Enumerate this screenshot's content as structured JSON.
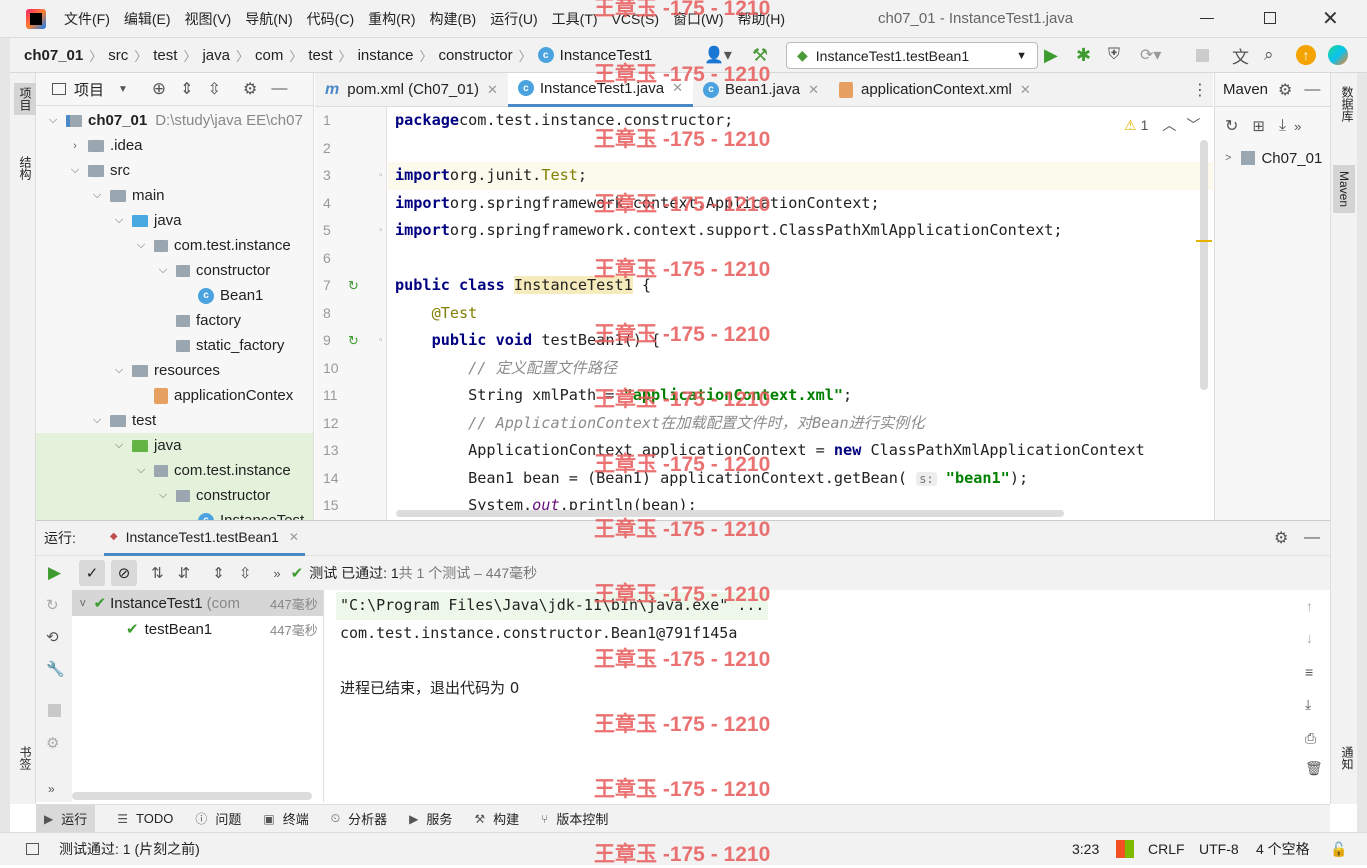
{
  "titlebar": {
    "menus": [
      "文件(F)",
      "编辑(E)",
      "视图(V)",
      "导航(N)",
      "代码(C)",
      "重构(R)",
      "构建(B)",
      "运行(U)",
      "工具(T)",
      "VCS(S)",
      "窗口(W)",
      "帮助(H)"
    ],
    "title": "ch07_01 - InstanceTest1.java"
  },
  "breadcrumb": [
    "ch07_01",
    "src",
    "test",
    "java",
    "com",
    "test",
    "instance",
    "constructor",
    "InstanceTest1"
  ],
  "run_config": "InstanceTest1.testBean1",
  "left_strip": {
    "project": "项目",
    "structure": "结构",
    "bookmarks": "书签"
  },
  "right_strip": {
    "database": "数据库",
    "maven": "Maven",
    "notifications": "通知"
  },
  "project_panel": {
    "title": "项目",
    "tree": [
      {
        "label": "ch07_01",
        "extra": "D:\\study\\java EE\\ch07",
        "indent": 0,
        "icon": "module",
        "chev": "v",
        "bold": true
      },
      {
        "label": ".idea",
        "indent": 1,
        "icon": "folder",
        "chev": ">"
      },
      {
        "label": "src",
        "indent": 1,
        "icon": "folder",
        "chev": "v"
      },
      {
        "label": "main",
        "indent": 2,
        "icon": "folder",
        "chev": "v"
      },
      {
        "label": "java",
        "indent": 3,
        "icon": "folder-blue",
        "chev": "v"
      },
      {
        "label": "com.test.instance",
        "indent": 4,
        "icon": "package",
        "chev": "v"
      },
      {
        "label": "constructor",
        "indent": 5,
        "icon": "package",
        "chev": "v"
      },
      {
        "label": "Bean1",
        "indent": 6,
        "icon": "class",
        "chev": ""
      },
      {
        "label": "factory",
        "indent": 5,
        "icon": "package",
        "chev": ""
      },
      {
        "label": "static_factory",
        "indent": 5,
        "icon": "package",
        "chev": ""
      },
      {
        "label": "resources",
        "indent": 3,
        "icon": "folder",
        "chev": "v"
      },
      {
        "label": "applicationContex",
        "indent": 4,
        "icon": "xml",
        "chev": ""
      },
      {
        "label": "test",
        "indent": 2,
        "icon": "folder",
        "chev": "v"
      },
      {
        "label": "java",
        "indent": 3,
        "icon": "folder-green",
        "chev": "v",
        "sel": true
      },
      {
        "label": "com.test.instance",
        "indent": 4,
        "icon": "package",
        "chev": "v",
        "sel": true
      },
      {
        "label": "constructor",
        "indent": 5,
        "icon": "package",
        "chev": "v",
        "sel": true
      },
      {
        "label": "InstanceTest",
        "indent": 6,
        "icon": "class",
        "chev": "",
        "sel": true
      }
    ]
  },
  "editor_tabs": [
    {
      "label": "pom.xml (Ch07_01)",
      "icon": "m",
      "active": false
    },
    {
      "label": "InstanceTest1.java",
      "icon": "c",
      "active": true
    },
    {
      "label": "Bean1.java",
      "icon": "c",
      "active": false
    },
    {
      "label": "applicationContext.xml",
      "icon": "xml",
      "active": false
    }
  ],
  "warnings": "1",
  "code_lines": [
    [
      [
        "kw",
        "package"
      ],
      [
        "",
        "com.test.instance.constructor;"
      ]
    ],
    [],
    [
      [
        "kw",
        "import"
      ],
      [
        "",
        "org.junit."
      ],
      [
        "ann",
        "Test"
      ],
      [
        "",
        ";"
      ]
    ],
    [
      [
        "kw",
        "import"
      ],
      [
        "",
        "org.springframework.context.ApplicationContext;"
      ]
    ],
    [
      [
        "kw",
        "import"
      ],
      [
        "",
        "org.springframework.context.support.ClassPathXmlApplicationContext;"
      ]
    ],
    [],
    [
      [
        "kw",
        "public class "
      ],
      [
        "hl",
        "InstanceTest1"
      ],
      [
        "",
        " {"
      ]
    ],
    [
      [
        "ann",
        "    @Test"
      ]
    ],
    [
      [
        "kw",
        "    public void "
      ],
      [
        "",
        "testBean1() {"
      ]
    ],
    [
      [
        "cmt",
        "        // 定义配置文件路径"
      ]
    ],
    [
      [
        "",
        "        String xmlPath = "
      ],
      [
        "str",
        "\"applicationContext.xml\""
      ],
      [
        "",
        ";"
      ]
    ],
    [
      [
        "cmt",
        "        // ApplicationContext在加载配置文件时，对Bean进行实例化"
      ]
    ],
    [
      [
        "",
        "        ApplicationContext applicationContext = "
      ],
      [
        "kw",
        "new "
      ],
      [
        "",
        "ClassPathXmlApplicationContext"
      ]
    ],
    [
      [
        "",
        "        Bean1 bean = (Bean1) applicationContext.getBean( "
      ],
      [
        "hint",
        "s:"
      ],
      [
        "str",
        " \"bean1\""
      ],
      [
        "",
        ");"
      ]
    ],
    [
      [
        "",
        "        System."
      ],
      [
        "fld",
        "out"
      ],
      [
        "",
        ".println(bean);"
      ]
    ]
  ],
  "line_numbers": [
    "1",
    "2",
    "3",
    "4",
    "5",
    "6",
    "7",
    "8",
    "9",
    "10",
    "11",
    "12",
    "13",
    "14",
    "15"
  ],
  "maven_panel": {
    "title": "Maven",
    "project": "Ch07_01"
  },
  "run_panel": {
    "label": "运行:",
    "tab": "InstanceTest1.testBean1",
    "status_prefix": "测试 已通过: ",
    "status_count": "1",
    "status_rest": "共 1 个测试 – 447毫秒",
    "tree": [
      {
        "label": "InstanceTest1",
        "extra": "(com",
        "time": "447毫秒"
      },
      {
        "label": "testBean1",
        "extra": "",
        "time": "447毫秒"
      }
    ],
    "console": [
      "\"C:\\Program Files\\Java\\jdk-11\\bin\\java.exe\" ...",
      "com.test.instance.constructor.Bean1@791f145a",
      "",
      "进程已结束，退出代码为 0"
    ]
  },
  "bottom_tabs": [
    "运行",
    "TODO",
    "问题",
    "终端",
    "分析器",
    "服务",
    "构建",
    "版本控制"
  ],
  "status": {
    "message": "测试通过: 1 (片刻之前)",
    "position": "3:23",
    "line_sep": "CRLF",
    "encoding": "UTF-8",
    "indent": "4 个空格"
  },
  "watermark": "王章玉 -175 - 1210"
}
